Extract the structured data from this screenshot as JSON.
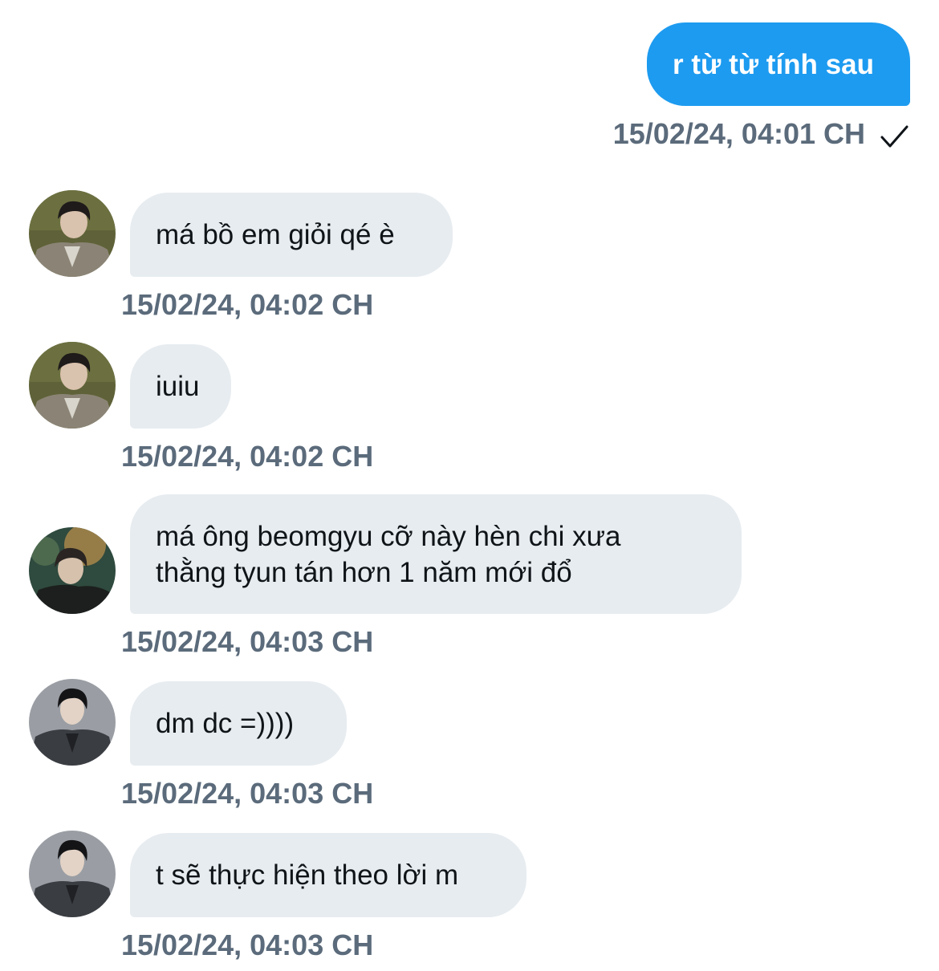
{
  "conversation": {
    "messages": [
      {
        "direction": "outgoing",
        "text": "r từ từ tính sau",
        "timestamp": "15/02/24, 04:01 CH",
        "status_icon": "checkmark-icon"
      },
      {
        "direction": "incoming",
        "text": "má bồ em giỏi qé è",
        "timestamp": "15/02/24, 04:02 CH",
        "avatar": "avatar-a"
      },
      {
        "direction": "incoming",
        "text": "iuiu",
        "timestamp": "15/02/24, 04:02 CH",
        "avatar": "avatar-a"
      },
      {
        "direction": "incoming",
        "text": "má ông beomgyu cỡ này hèn chi xưa\nthằng tyun tán hơn 1 năm mới đổ",
        "timestamp": "15/02/24, 04:03 CH",
        "avatar": "avatar-b"
      },
      {
        "direction": "incoming",
        "text": "dm dc =))))",
        "timestamp": "15/02/24, 04:03 CH",
        "avatar": "avatar-c"
      },
      {
        "direction": "incoming",
        "text": "t sẽ thực hiện theo lời m",
        "timestamp": "15/02/24, 04:03 CH",
        "avatar": "avatar-c"
      }
    ]
  },
  "colors": {
    "outgoing_bubble": "#1d9bf0",
    "incoming_bubble": "#e7ecf0",
    "timestamp_text": "#5b6b7b",
    "message_text": "#0f1419"
  }
}
